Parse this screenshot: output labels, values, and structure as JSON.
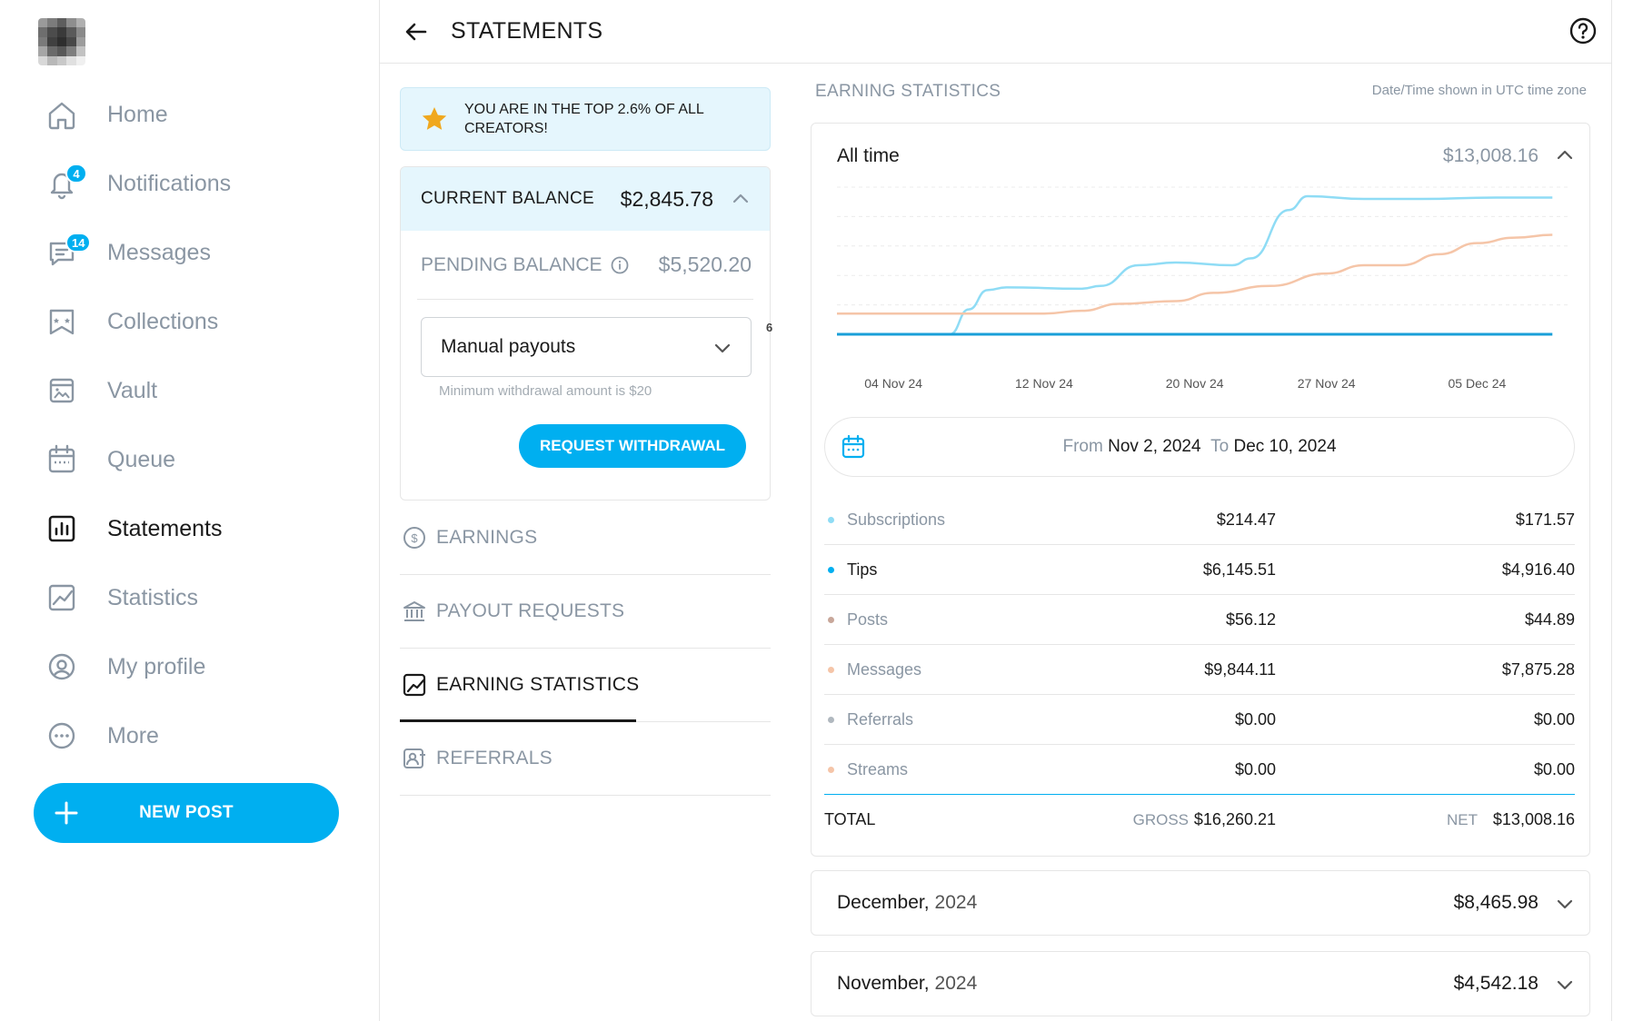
{
  "colors": {
    "accent": "#00aff0",
    "muted": "#8a96a3",
    "line_blue": "#8fdcf5",
    "line_peach": "#f5c5a8",
    "star": "#f0a81e"
  },
  "sidebar": {
    "items": [
      {
        "key": "home",
        "label": "Home",
        "icon": "home-icon",
        "badge": null,
        "active": false
      },
      {
        "key": "notifications",
        "label": "Notifications",
        "icon": "bell-icon",
        "badge": "4",
        "active": false
      },
      {
        "key": "messages",
        "label": "Messages",
        "icon": "message-icon",
        "badge": "14",
        "active": false
      },
      {
        "key": "collections",
        "label": "Collections",
        "icon": "collections-icon",
        "badge": null,
        "active": false
      },
      {
        "key": "vault",
        "label": "Vault",
        "icon": "vault-icon",
        "badge": null,
        "active": false
      },
      {
        "key": "queue",
        "label": "Queue",
        "icon": "calendar-icon",
        "badge": null,
        "active": false
      },
      {
        "key": "statements",
        "label": "Statements",
        "icon": "bar-chart-icon",
        "badge": null,
        "active": true
      },
      {
        "key": "statistics",
        "label": "Statistics",
        "icon": "trend-icon",
        "badge": null,
        "active": false
      },
      {
        "key": "profile",
        "label": "My profile",
        "icon": "profile-icon",
        "badge": null,
        "active": false
      },
      {
        "key": "more",
        "label": "More",
        "icon": "more-icon",
        "badge": null,
        "active": false
      }
    ],
    "new_post": "NEW POST"
  },
  "header": {
    "title": "STATEMENTS"
  },
  "banner": {
    "text": "YOU ARE IN THE TOP 2.6% OF ALL CREATORS!"
  },
  "balance": {
    "current_label": "CURRENT BALANCE",
    "current_amount": "$2,845.78",
    "pending_label": "PENDING BALANCE",
    "pending_amount": "$5,520.20",
    "payout_select": "Manual payouts",
    "min_note": "Minimum withdrawal amount is $20",
    "request_button": "REQUEST WITHDRAWAL",
    "stray_text": "6"
  },
  "tabs": [
    {
      "label": "EARNINGS",
      "icon": "dollar-circle-icon",
      "active": false
    },
    {
      "label": "PAYOUT REQUESTS",
      "icon": "bank-icon",
      "active": false
    },
    {
      "label": "EARNING STATISTICS",
      "icon": "trend-icon",
      "active": true
    },
    {
      "label": "REFERRALS",
      "icon": "referral-icon",
      "active": false
    }
  ],
  "stats": {
    "section_title": "EARNING STATISTICS",
    "timezone_note": "Date/Time shown in UTC time zone",
    "period_label": "All time",
    "period_total": "$13,008.16",
    "date_from_label": "From",
    "date_from": "Nov 2, 2024",
    "date_to_label": "To",
    "date_to": "Dec 10, 2024",
    "rows": [
      {
        "name": "Subscriptions",
        "gross": "$214.47",
        "net": "$171.57",
        "dot": "#8fdcf5",
        "strong": false
      },
      {
        "name": "Tips",
        "gross": "$6,145.51",
        "net": "$4,916.40",
        "dot": "#00aff0",
        "strong": true
      },
      {
        "name": "Posts",
        "gross": "$56.12",
        "net": "$44.89",
        "dot": "#c8a79a",
        "strong": false
      },
      {
        "name": "Messages",
        "gross": "$9,844.11",
        "net": "$7,875.28",
        "dot": "#f5c5a8",
        "strong": false
      },
      {
        "name": "Referrals",
        "gross": "$0.00",
        "net": "$0.00",
        "dot": "#b0b8bf",
        "strong": false
      },
      {
        "name": "Streams",
        "gross": "$0.00",
        "net": "$0.00",
        "dot": "#f5c5a8",
        "strong": false
      }
    ],
    "total": {
      "label": "TOTAL",
      "gross_label": "GROSS",
      "gross": "$16,260.21",
      "net_label": "NET",
      "net": "$13,008.16"
    },
    "months": [
      {
        "name": "December,",
        "year": "2024",
        "amount": "$8,465.98"
      },
      {
        "name": "November,",
        "year": "2024",
        "amount": "$4,542.18"
      }
    ]
  },
  "chart_data": {
    "type": "line",
    "x_ticks": [
      "04 Nov 24",
      "12 Nov 24",
      "20 Nov 24",
      "27 Nov 24",
      "05 Dec 24"
    ],
    "x_tick_positions_days": [
      2,
      10,
      18,
      25,
      33
    ],
    "x_range_days": [
      -1,
      38
    ],
    "grid": true,
    "y_range": [
      0,
      1
    ],
    "series": [
      {
        "color": "#8fdcf5",
        "points": [
          [
            -1,
            0
          ],
          [
            5,
            0
          ],
          [
            6,
            0.18
          ],
          [
            7,
            0.32
          ],
          [
            8,
            0.34
          ],
          [
            12,
            0.33
          ],
          [
            13,
            0.35
          ],
          [
            15,
            0.5
          ],
          [
            17,
            0.52
          ],
          [
            20,
            0.5
          ],
          [
            21,
            0.55
          ],
          [
            23,
            0.9
          ],
          [
            24,
            1.0
          ],
          [
            27,
            0.98
          ],
          [
            30,
            0.98
          ],
          [
            34,
            0.99
          ],
          [
            37,
            0.99
          ]
        ]
      },
      {
        "color": "#f5c5a8",
        "points": [
          [
            -1,
            0.15
          ],
          [
            10,
            0.15
          ],
          [
            12,
            0.17
          ],
          [
            14,
            0.22
          ],
          [
            17,
            0.24
          ],
          [
            19,
            0.3
          ],
          [
            22,
            0.35
          ],
          [
            25,
            0.44
          ],
          [
            27,
            0.5
          ],
          [
            29,
            0.5
          ],
          [
            31,
            0.58
          ],
          [
            33,
            0.66
          ],
          [
            35,
            0.7
          ],
          [
            37,
            0.72
          ]
        ]
      },
      {
        "color": "#1a9fd8",
        "points": [
          [
            -1,
            0
          ],
          [
            37,
            0
          ]
        ]
      }
    ]
  }
}
